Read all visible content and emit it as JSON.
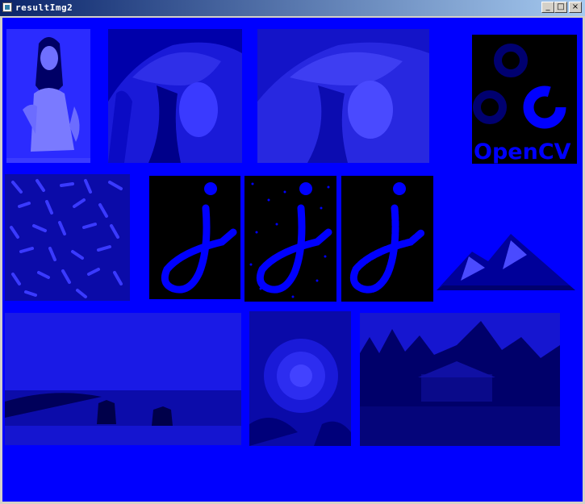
{
  "window": {
    "title": "resultImg2",
    "icon": "window-app-icon",
    "controls": {
      "minimize": "_",
      "maximize": "□",
      "close": "×"
    }
  },
  "canvas": {
    "background": "#0000ff"
  },
  "images": [
    {
      "name": "woman-portrait-image"
    },
    {
      "name": "lena-image"
    },
    {
      "name": "lena-bright-image"
    },
    {
      "name": "opencv-logo-image",
      "text": "OpenCV"
    },
    {
      "name": "rice-texture-image"
    },
    {
      "name": "j-letter-image"
    },
    {
      "name": "j-letter-noise-image"
    },
    {
      "name": "j-letter-holes-image"
    },
    {
      "name": "mountain-icon-image"
    },
    {
      "name": "seascape-image"
    },
    {
      "name": "flower-image"
    },
    {
      "name": "forest-house-image"
    }
  ]
}
